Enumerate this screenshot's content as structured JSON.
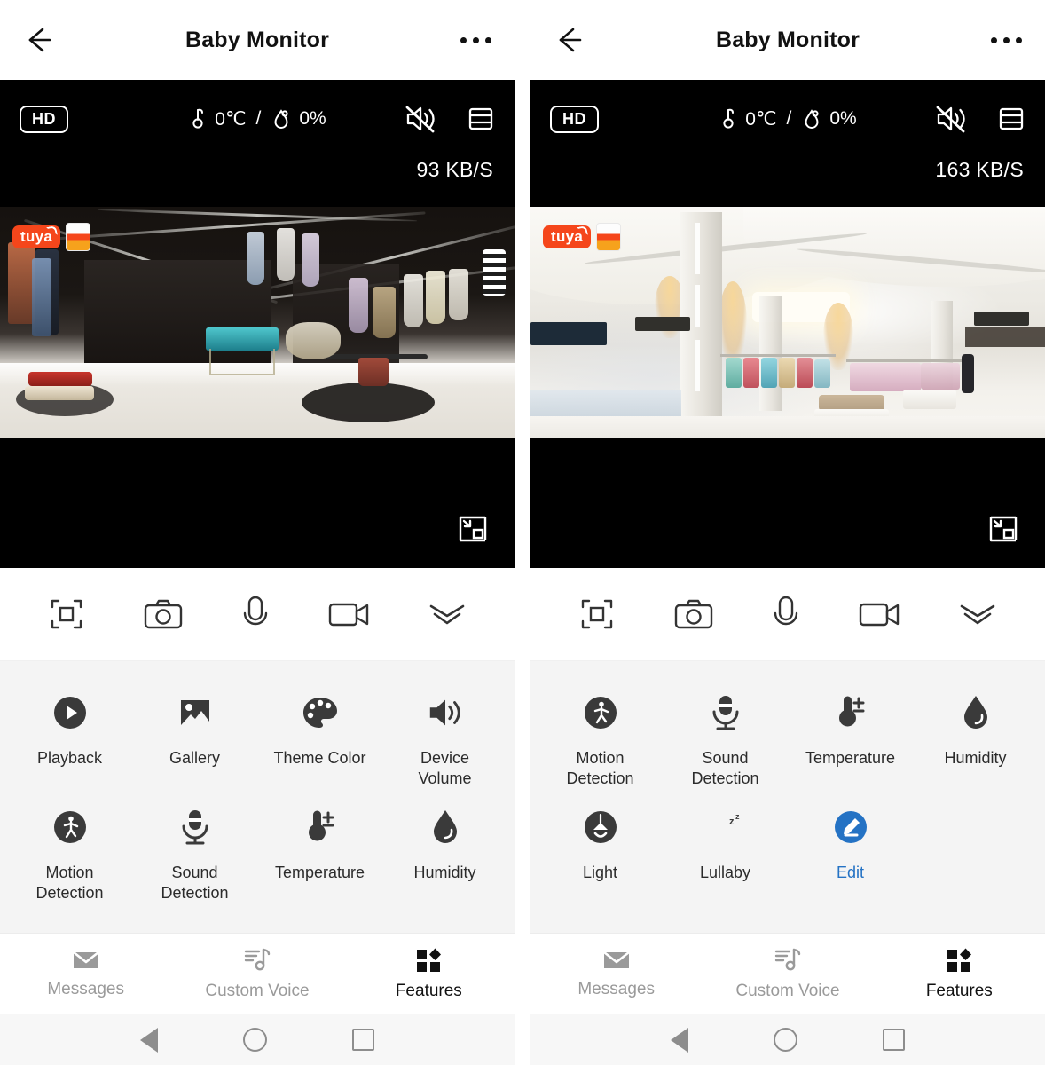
{
  "app": {
    "title": "Baby Monitor",
    "accent_blue": "#2472c4",
    "tuya_orange": "#f5461b"
  },
  "panels": [
    {
      "id": "left",
      "header": {
        "title": "Baby Monitor",
        "back_icon": "back-arrow-icon",
        "more_icon": "more-options-icon"
      },
      "video": {
        "quality_badge": "HD",
        "temperature": "0℃",
        "separator": "/",
        "humidity": "0%",
        "bitrate": "93 KB/S",
        "mute_icon": "speaker-muted-icon",
        "split_icon": "split-screen-icon",
        "pip_icon": "picture-in-picture-icon",
        "watermark": "tuya",
        "scene": "dark-boutique"
      },
      "controls": [
        {
          "name": "fullscreen-button",
          "icon": "fullscreen-icon"
        },
        {
          "name": "snapshot-button",
          "icon": "camera-icon"
        },
        {
          "name": "talk-button",
          "icon": "microphone-icon"
        },
        {
          "name": "record-button",
          "icon": "video-camera-icon"
        },
        {
          "name": "collapse-button",
          "icon": "double-chevron-down-icon"
        }
      ],
      "features": [
        {
          "label": "Playback",
          "icon": "play-circle-icon"
        },
        {
          "label": "Gallery",
          "icon": "photo-icon"
        },
        {
          "label": "Theme Color",
          "icon": "palette-icon"
        },
        {
          "label": "Device Volume",
          "icon": "speaker-volume-icon"
        },
        {
          "label": "Motion Detection",
          "icon": "walking-person-circle-icon"
        },
        {
          "label": "Sound Detection",
          "icon": "microphone-detect-icon"
        },
        {
          "label": "Temperature",
          "icon": "thermometer-icon"
        },
        {
          "label": "Humidity",
          "icon": "water-drop-icon"
        }
      ],
      "tabs": [
        {
          "label": "Messages",
          "icon": "envelope-icon",
          "active": false
        },
        {
          "label": "Custom Voice",
          "icon": "music-note-list-icon",
          "active": false
        },
        {
          "label": "Features",
          "icon": "grid-features-icon",
          "active": true
        }
      ]
    },
    {
      "id": "right",
      "header": {
        "title": "Baby Monitor",
        "back_icon": "back-arrow-icon",
        "more_icon": "more-options-icon"
      },
      "video": {
        "quality_badge": "HD",
        "temperature": "0℃",
        "separator": "/",
        "humidity": "0%",
        "bitrate": "163 KB/S",
        "mute_icon": "speaker-muted-icon",
        "split_icon": "split-screen-icon",
        "pip_icon": "picture-in-picture-icon",
        "watermark": "tuya",
        "scene": "bright-mall"
      },
      "controls": [
        {
          "name": "fullscreen-button",
          "icon": "fullscreen-icon"
        },
        {
          "name": "snapshot-button",
          "icon": "camera-icon"
        },
        {
          "name": "talk-button",
          "icon": "microphone-icon"
        },
        {
          "name": "record-button",
          "icon": "video-camera-icon"
        },
        {
          "name": "collapse-button",
          "icon": "double-chevron-down-icon"
        }
      ],
      "features": [
        {
          "label": "Motion Detection",
          "icon": "walking-person-circle-icon"
        },
        {
          "label": "Sound Detection",
          "icon": "microphone-detect-icon"
        },
        {
          "label": "Temperature",
          "icon": "thermometer-icon"
        },
        {
          "label": "Humidity",
          "icon": "water-drop-icon"
        },
        {
          "label": "Light",
          "icon": "lamp-circle-icon"
        },
        {
          "label": "Lullaby",
          "icon": "moon-sleep-icon"
        },
        {
          "label": "Edit",
          "icon": "pencil-circle-icon"
        }
      ],
      "tabs": [
        {
          "label": "Messages",
          "icon": "envelope-icon",
          "active": false
        },
        {
          "label": "Custom Voice",
          "icon": "music-note-list-icon",
          "active": false
        },
        {
          "label": "Features",
          "icon": "grid-features-icon",
          "active": true
        }
      ]
    }
  ],
  "android_nav": {
    "back": "triangle-back-icon",
    "home": "circle-home-icon",
    "recents": "square-recents-icon"
  }
}
